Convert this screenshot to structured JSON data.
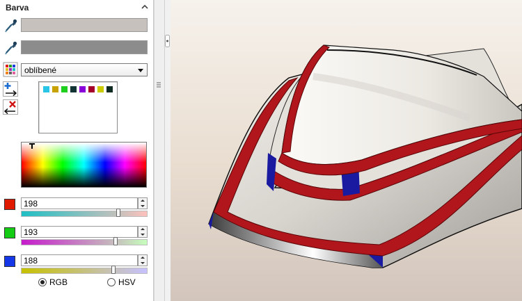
{
  "panel": {
    "title": "Barva",
    "palette_select": {
      "value": "oblíbené"
    },
    "favorites": [
      "#29c5e6",
      "#c8a200",
      "#1fcf1f",
      "#113333",
      "#8a00d8",
      "#a4002b",
      "#cccc00",
      "#102b22"
    ],
    "swatch_colors": {
      "primary": "#c6c1bc",
      "secondary": "#8c8c8c"
    },
    "rgb": {
      "red": {
        "value": "198",
        "fraction": 0.776
      },
      "green": {
        "value": "193",
        "fraction": 0.757
      },
      "blue": {
        "value": "188",
        "fraction": 0.737
      }
    },
    "mode": {
      "rgb_label": "RGB",
      "hsv_label": "HSV",
      "selected": "RGB"
    }
  },
  "icons": {
    "collapse": "chevron-up-icon",
    "eyedropper": "eyedropper-icon",
    "palette": "palette-grid-icon",
    "add": "add-to-favorites-icon",
    "remove": "remove-from-favorites-icon"
  },
  "viewport": {
    "model_colors": {
      "body": "#d9d6d0",
      "trim": "#b0161b",
      "accent": "#1a1aa0"
    }
  }
}
